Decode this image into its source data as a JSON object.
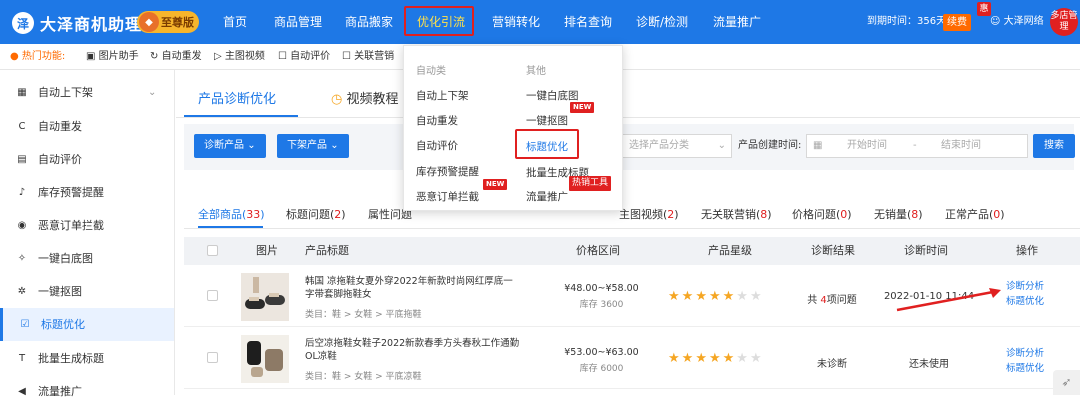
{
  "app": {
    "logo_mark": "泽",
    "name": "大泽商机助理",
    "vip_icon": "◆",
    "vip": "至尊版"
  },
  "nav": {
    "items": [
      "首页",
      "商品管理",
      "商品搬家",
      "优化引流",
      "营销转化",
      "排名查询",
      "诊断/检测",
      "流量推广"
    ],
    "expire_text": "到期时间：356天",
    "renew": "续费",
    "hui": "惠",
    "user": "大泽网络",
    "multi_store": "多店管理"
  },
  "hotbar": {
    "label": "热门功能:",
    "items": [
      "图片助手",
      "自动重发",
      "主图视频",
      "自动评价",
      "关联营销"
    ]
  },
  "sidebar": {
    "items": [
      {
        "label": "自动上下架",
        "icon": "grid-icon"
      },
      {
        "label": "自动重发",
        "icon": "refresh-icon"
      },
      {
        "label": "自动评价",
        "icon": "comment-icon"
      },
      {
        "label": "库存预警提醒",
        "icon": "bell-icon"
      },
      {
        "label": "恶意订单拦截",
        "icon": "shield-icon"
      },
      {
        "label": "一键白底图",
        "icon": "wand-icon"
      },
      {
        "label": "一键抠图",
        "icon": "cutout-icon"
      },
      {
        "label": "标题优化",
        "icon": "check-icon"
      },
      {
        "label": "批量生成标题",
        "icon": "title-icon"
      },
      {
        "label": "流量推广",
        "icon": "megaphone-icon"
      }
    ]
  },
  "main": {
    "tabs": [
      "产品诊断优化",
      "视频教程"
    ],
    "filter": {
      "btn1": "诊断产品",
      "btn2": "下架产品",
      "category_placeholder": "选择产品分类",
      "created_label": "产品创建时间:",
      "start_placeholder": "开始时间",
      "sep": "-",
      "end_placeholder": "结束时间",
      "search": "搜索"
    },
    "status_tabs": [
      {
        "label": "全部商品",
        "count": "33"
      },
      {
        "label": "标题问题",
        "count": "2"
      },
      {
        "label": "属性问题",
        "count": ""
      },
      {
        "label": "主图视频",
        "count": "2"
      },
      {
        "label": "无关联营销",
        "count": "8"
      },
      {
        "label": "价格问题",
        "count": "0"
      },
      {
        "label": "无销量",
        "count": "8"
      },
      {
        "label": "正常产品",
        "count": "0"
      }
    ],
    "columns": [
      "图片",
      "产品标题",
      "价格区间",
      "产品星级",
      "诊断结果",
      "诊断时间",
      "操作"
    ],
    "rows": [
      {
        "title": "韩国 凉拖鞋女夏外穿2022年新款时尚网红厚底一字带套脚拖鞋女",
        "category": "类目：鞋 > 女鞋 > 平底拖鞋",
        "price": "¥48.00~¥58.00",
        "stock": "库存 3600",
        "stars": 5,
        "result_prefix": "共",
        "result_count": "4",
        "result_suffix": "项问题",
        "time": "2022-01-10 11:44",
        "op1": "诊断分析",
        "op2": "标题优化"
      },
      {
        "title": "后空凉拖鞋女鞋子2022新款春季方头春秋工作通勤OL凉鞋",
        "category": "类目：鞋 > 女鞋 > 平底凉鞋",
        "price": "¥53.00~¥63.00",
        "stock": "库存 6000",
        "stars": 5,
        "result": "未诊断",
        "time": "还未使用",
        "op1": "诊断分析",
        "op2": "标题优化"
      }
    ]
  },
  "dropdown": {
    "col1_head": "自动类",
    "col1": [
      "自动上下架",
      "自动重发",
      "自动评价",
      "库存预警提醒",
      "恶意订单拦截"
    ],
    "col2_head": "其他",
    "col2": [
      "一键白底图",
      "一键抠图",
      "标题优化",
      "批量生成标题",
      "流量推广"
    ],
    "new": "NEW",
    "hot": "热销工具"
  },
  "colors": {
    "primary": "#1e78e6",
    "accent_red": "#e02020",
    "star": "#f5a623",
    "orange": "#ff6a00"
  }
}
